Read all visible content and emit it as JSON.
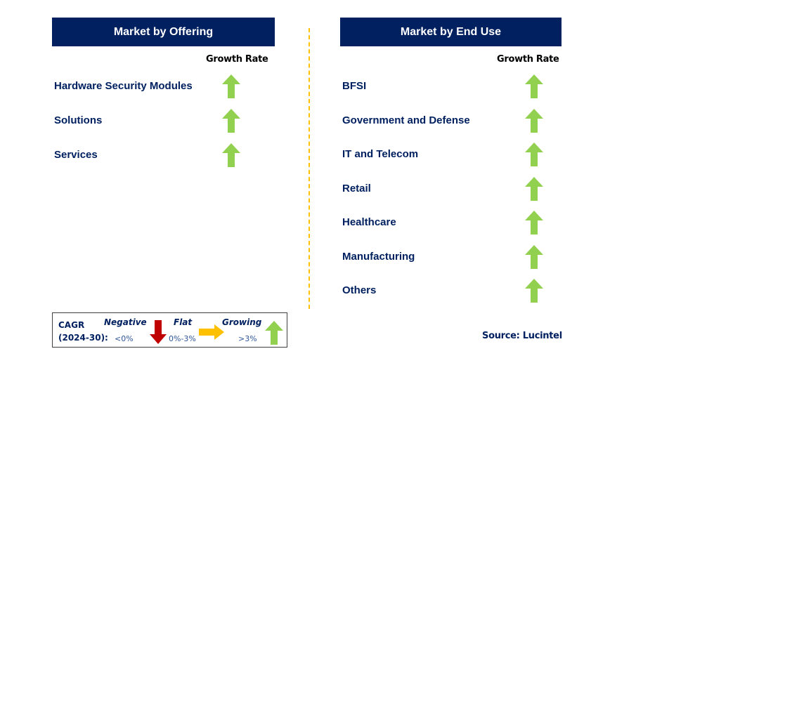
{
  "left_panel": {
    "title": "Market by Offering",
    "growth_rate_label": "Growth Rate",
    "items": [
      {
        "label": "Hardware Security Modules",
        "trend": "growing"
      },
      {
        "label": "Solutions",
        "trend": "growing"
      },
      {
        "label": "Services",
        "trend": "growing"
      }
    ]
  },
  "right_panel": {
    "title": "Market by End Use",
    "growth_rate_label": "Growth Rate",
    "items": [
      {
        "label": "BFSI",
        "trend": "growing"
      },
      {
        "label": "Government and Defense",
        "trend": "growing"
      },
      {
        "label": "IT and Telecom",
        "trend": "growing"
      },
      {
        "label": "Retail",
        "trend": "growing"
      },
      {
        "label": "Healthcare",
        "trend": "growing"
      },
      {
        "label": "Manufacturing",
        "trend": "growing"
      },
      {
        "label": "Others",
        "trend": "growing"
      }
    ]
  },
  "legend": {
    "cagr_line1": "CAGR",
    "cagr_line2": "(2024-30):",
    "negative": {
      "label": "Negative",
      "range": "<0%",
      "icon": "arrow-down-icon",
      "color": "#C00000"
    },
    "flat": {
      "label": "Flat",
      "range": "0%-3%",
      "icon": "arrow-right-icon",
      "color": "#FFC000"
    },
    "growing": {
      "label": "Growing",
      "range": ">3%",
      "icon": "arrow-up-icon",
      "color": "#92D050"
    }
  },
  "source": "Source: Lucintel",
  "colors": {
    "header_bg": "#002060",
    "label_text": "#002060",
    "divider": "#FFC000",
    "up_arrow": "#92D050"
  }
}
